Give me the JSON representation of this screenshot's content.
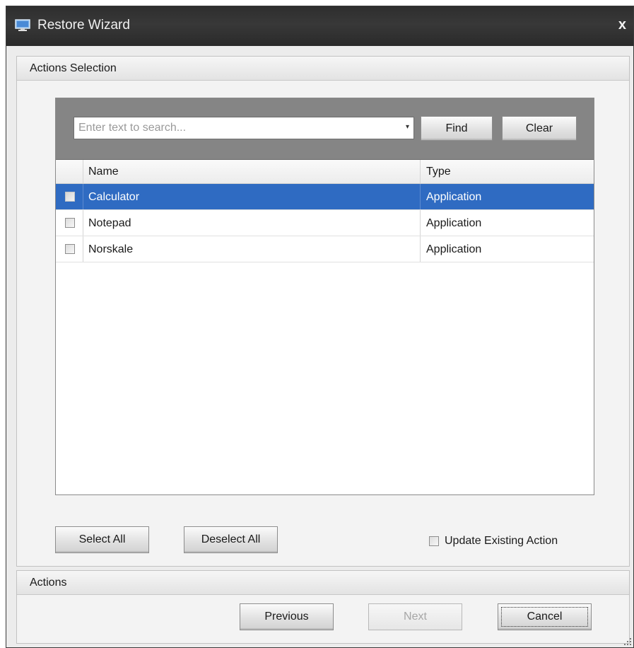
{
  "window": {
    "title": "Restore Wizard",
    "close_glyph": "x",
    "icon": "monitor-icon"
  },
  "actions_selection": {
    "header": "Actions Selection",
    "search": {
      "placeholder": "Enter text to search...",
      "value": "",
      "dropdown_glyph": "▾"
    },
    "find_label": "Find",
    "clear_label": "Clear",
    "columns": {
      "name": "Name",
      "type": "Type"
    },
    "rows": [
      {
        "name": "Calculator",
        "type": "Application",
        "selected": true
      },
      {
        "name": "Notepad",
        "type": "Application",
        "selected": false
      },
      {
        "name": "Norskale",
        "type": "Application",
        "selected": false
      }
    ],
    "select_all_label": "Select All",
    "deselect_all_label": "Deselect All",
    "update_existing_label": "Update Existing Action"
  },
  "actions": {
    "header": "Actions",
    "previous_label": "Previous",
    "next_label": "Next",
    "cancel_label": "Cancel"
  },
  "colors": {
    "titlebar": "#333333",
    "selection": "#2f6bc2",
    "find_panel": "#858585"
  }
}
